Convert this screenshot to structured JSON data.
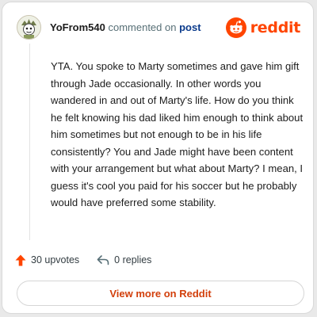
{
  "header": {
    "username": "YoFrom540",
    "verb": "commented on",
    "post_link": "post",
    "brand": "reddit"
  },
  "comment": {
    "text": "YTA. You spoke to Marty sometimes and gave him gift through Jade occasionally. In other words you wandered in and out of Marty's life. How do you think he felt knowing his dad liked him enough to think about him sometimes but not enough to be in his life consistently? You and Jade might have been content with your arrangement but what about Marty? I mean, I guess it's cool you paid for his soccer but he probably would have preferred some stability."
  },
  "actions": {
    "upvotes": "30 upvotes",
    "replies": "0 replies"
  },
  "cta": {
    "label": "View more on Reddit"
  },
  "colors": {
    "brand": "#ff4500",
    "cta_text": "#d23f0b",
    "link": "#0b3b8c"
  },
  "icons": {
    "avatar": "avatar",
    "brand_logo": "reddit-snoo-icon",
    "upvote": "upvote-arrow-icon",
    "reply": "reply-arrow-icon"
  }
}
